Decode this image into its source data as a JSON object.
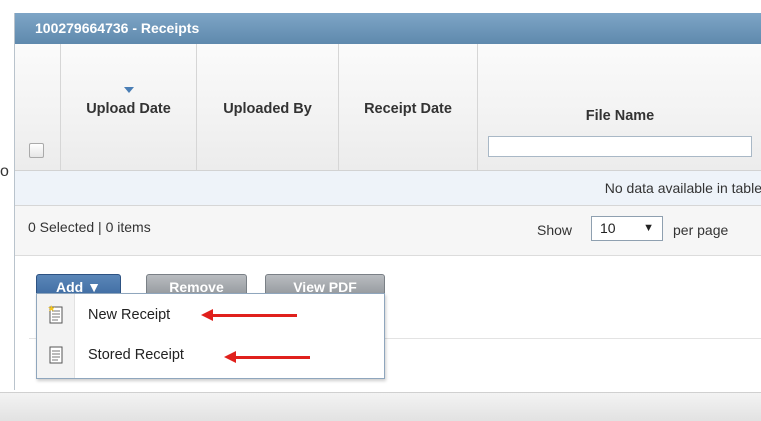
{
  "panel": {
    "title": "100279664736 - Receipts"
  },
  "table": {
    "columns": [
      "Upload Date",
      "Uploaded By",
      "Receipt Date",
      "File Name"
    ],
    "sorted_column": "Upload Date",
    "file_name_filter": "",
    "empty_message": "No data available in table"
  },
  "pager": {
    "selection_summary": "0 Selected | 0 items",
    "show_label": "Show",
    "per_page_value": "10",
    "per_page_label": "per page"
  },
  "toolbar": {
    "add_label": "Add ▼",
    "remove_label": "Remove",
    "view_pdf_label": "View PDF"
  },
  "add_menu": {
    "items": [
      {
        "label": "New Receipt",
        "icon": "new-receipt-icon"
      },
      {
        "label": "Stored Receipt",
        "icon": "receipt-icon"
      }
    ]
  },
  "stray_char": "o",
  "colors": {
    "titlebar": "#6a93b8",
    "add_button": "#3c69a0",
    "annotation_arrow": "#e0201c",
    "nodata_row": "#eef3f9"
  }
}
